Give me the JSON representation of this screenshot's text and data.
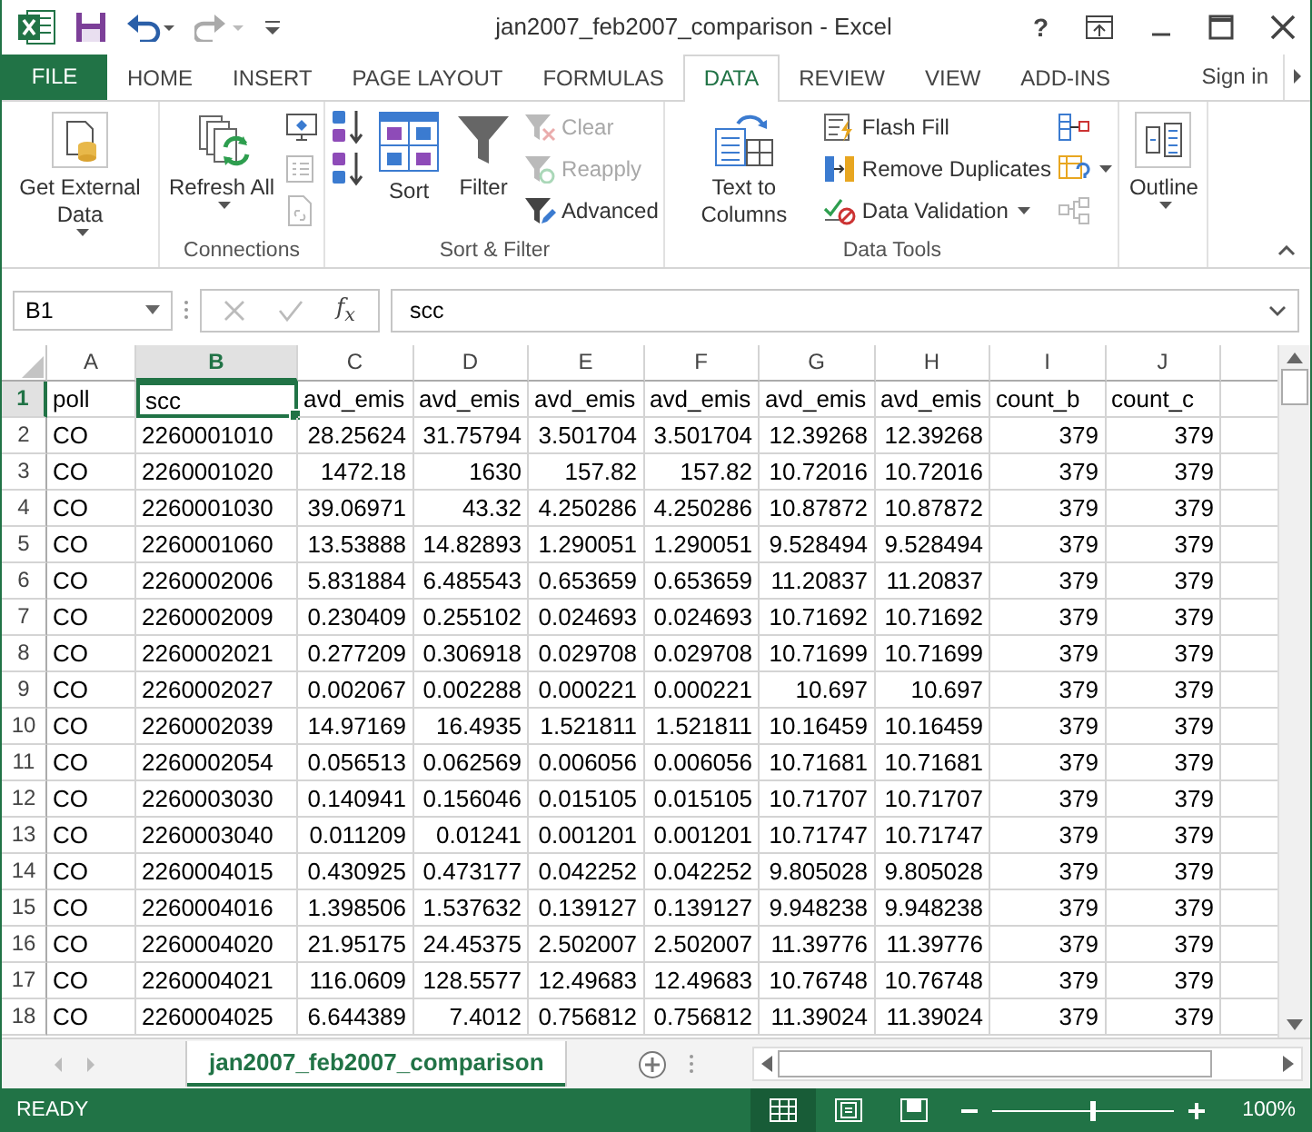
{
  "window": {
    "title": "jan2007_feb2007_comparison - Excel",
    "help": "?"
  },
  "ribbon_tabs": [
    {
      "label": "FILE",
      "kind": "file",
      "selected": false
    },
    {
      "label": "HOME",
      "kind": "tab",
      "selected": false
    },
    {
      "label": "INSERT",
      "kind": "tab",
      "selected": false
    },
    {
      "label": "PAGE LAYOUT",
      "kind": "tab",
      "selected": false
    },
    {
      "label": "FORMULAS",
      "kind": "tab",
      "selected": false
    },
    {
      "label": "DATA",
      "kind": "tab",
      "selected": true
    },
    {
      "label": "REVIEW",
      "kind": "tab",
      "selected": false
    },
    {
      "label": "VIEW",
      "kind": "tab",
      "selected": false
    },
    {
      "label": "ADD-INS",
      "kind": "tab",
      "selected": false
    }
  ],
  "sign_in": "Sign in",
  "ribbon_groups": [
    {
      "items": [
        {
          "kind": "large",
          "label": "Get External Data",
          "dropdown": true,
          "disabled": false
        }
      ]
    },
    {
      "label": "Connections",
      "items": [
        {
          "kind": "large",
          "label": "Refresh All",
          "dropdown": true,
          "disabled": false
        },
        {
          "kind": "stack",
          "commands": [
            {
              "disabled": false
            },
            {
              "disabled": true
            },
            {
              "disabled": true
            }
          ]
        }
      ]
    },
    {
      "label": "Sort & Filter",
      "items": [
        {
          "kind": "stack",
          "commands": [
            {
              "disabled": false
            },
            {
              "disabled": false
            }
          ]
        },
        {
          "kind": "large",
          "label": "Sort",
          "disabled": false
        },
        {
          "kind": "large",
          "label": "Filter",
          "disabled": false
        },
        {
          "kind": "stack",
          "commands": [
            {
              "label": "Clear",
              "disabled": true
            },
            {
              "label": "Reapply",
              "disabled": true
            },
            {
              "label": "Advanced",
              "disabled": false
            }
          ]
        }
      ]
    },
    {
      "label": "Data Tools",
      "items": [
        {
          "kind": "large",
          "label": "Text to Columns",
          "disabled": false
        },
        {
          "kind": "stack",
          "commands": [
            {
              "label": "Flash Fill",
              "disabled": false
            },
            {
              "label": "Remove Duplicates",
              "disabled": false
            },
            {
              "label": "Data Validation",
              "dropdown": true,
              "disabled": false
            }
          ]
        },
        {
          "kind": "stack",
          "commands": [
            {
              "disabled": false
            },
            {
              "dropdown": true,
              "disabled": false
            },
            {
              "disabled": true
            }
          ]
        }
      ]
    },
    {
      "items": [
        {
          "kind": "large",
          "label": "Outline",
          "dropdown": true,
          "disabled": false
        }
      ]
    }
  ],
  "formula_bar": {
    "name_box": "B1",
    "function_label": "f$_{x}$",
    "formula": "scc"
  },
  "sheet": {
    "columns": [
      {
        "label": "A",
        "kind": "text",
        "selected": false
      },
      {
        "label": "B",
        "kind": "text",
        "selected": true
      },
      {
        "label": "C",
        "kind": "number",
        "selected": false
      },
      {
        "label": "D",
        "kind": "number",
        "selected": false
      },
      {
        "label": "E",
        "kind": "number",
        "selected": false
      },
      {
        "label": "F",
        "kind": "number",
        "selected": false
      },
      {
        "label": "G",
        "kind": "number",
        "selected": false
      },
      {
        "label": "H",
        "kind": "number",
        "selected": false
      },
      {
        "label": "I",
        "kind": "number",
        "selected": false
      },
      {
        "label": "J",
        "kind": "number",
        "selected": false
      }
    ],
    "rows": [
      {
        "number": "1",
        "kind": "header",
        "selected": true,
        "cells": [
          "poll",
          "scc",
          "avd_emis",
          "avd_emis",
          "avd_emis",
          "avd_emis",
          "avd_emis",
          "avd_emis",
          "count_b",
          "count_c"
        ]
      },
      {
        "number": "2",
        "kind": "data",
        "selected": false,
        "cells": [
          "CO",
          "2260001010",
          "28.25624",
          "31.75794",
          "3.501704",
          "3.501704",
          "12.39268",
          "12.39268",
          "379",
          "379"
        ]
      },
      {
        "number": "3",
        "kind": "data",
        "selected": false,
        "cells": [
          "CO",
          "2260001020",
          "1472.18",
          "1630",
          "157.82",
          "157.82",
          "10.72016",
          "10.72016",
          "379",
          "379"
        ]
      },
      {
        "number": "4",
        "kind": "data",
        "selected": false,
        "cells": [
          "CO",
          "2260001030",
          "39.06971",
          "43.32",
          "4.250286",
          "4.250286",
          "10.87872",
          "10.87872",
          "379",
          "379"
        ]
      },
      {
        "number": "5",
        "kind": "data",
        "selected": false,
        "cells": [
          "CO",
          "2260001060",
          "13.53888",
          "14.82893",
          "1.290051",
          "1.290051",
          "9.528494",
          "9.528494",
          "379",
          "379"
        ]
      },
      {
        "number": "6",
        "kind": "data",
        "selected": false,
        "cells": [
          "CO",
          "2260002006",
          "5.831884",
          "6.485543",
          "0.653659",
          "0.653659",
          "11.20837",
          "11.20837",
          "379",
          "379"
        ]
      },
      {
        "number": "7",
        "kind": "data",
        "selected": false,
        "cells": [
          "CO",
          "2260002009",
          "0.230409",
          "0.255102",
          "0.024693",
          "0.024693",
          "10.71692",
          "10.71692",
          "379",
          "379"
        ]
      },
      {
        "number": "8",
        "kind": "data",
        "selected": false,
        "cells": [
          "CO",
          "2260002021",
          "0.277209",
          "0.306918",
          "0.029708",
          "0.029708",
          "10.71699",
          "10.71699",
          "379",
          "379"
        ]
      },
      {
        "number": "9",
        "kind": "data",
        "selected": false,
        "cells": [
          "CO",
          "2260002027",
          "0.002067",
          "0.002288",
          "0.000221",
          "0.000221",
          "10.697",
          "10.697",
          "379",
          "379"
        ]
      },
      {
        "number": "10",
        "kind": "data",
        "selected": false,
        "cells": [
          "CO",
          "2260002039",
          "14.97169",
          "16.4935",
          "1.521811",
          "1.521811",
          "10.16459",
          "10.16459",
          "379",
          "379"
        ]
      },
      {
        "number": "11",
        "kind": "data",
        "selected": false,
        "cells": [
          "CO",
          "2260002054",
          "0.056513",
          "0.062569",
          "0.006056",
          "0.006056",
          "10.71681",
          "10.71681",
          "379",
          "379"
        ]
      },
      {
        "number": "12",
        "kind": "data",
        "selected": false,
        "cells": [
          "CO",
          "2260003030",
          "0.140941",
          "0.156046",
          "0.015105",
          "0.015105",
          "10.71707",
          "10.71707",
          "379",
          "379"
        ]
      },
      {
        "number": "13",
        "kind": "data",
        "selected": false,
        "cells": [
          "CO",
          "2260003040",
          "0.011209",
          "0.01241",
          "0.001201",
          "0.001201",
          "10.71747",
          "10.71747",
          "379",
          "379"
        ]
      },
      {
        "number": "14",
        "kind": "data",
        "selected": false,
        "cells": [
          "CO",
          "2260004015",
          "0.430925",
          "0.473177",
          "0.042252",
          "0.042252",
          "9.805028",
          "9.805028",
          "379",
          "379"
        ]
      },
      {
        "number": "15",
        "kind": "data",
        "selected": false,
        "cells": [
          "CO",
          "2260004016",
          "1.398506",
          "1.537632",
          "0.139127",
          "0.139127",
          "9.948238",
          "9.948238",
          "379",
          "379"
        ]
      },
      {
        "number": "16",
        "kind": "data",
        "selected": false,
        "cells": [
          "CO",
          "2260004020",
          "21.95175",
          "24.45375",
          "2.502007",
          "2.502007",
          "11.39776",
          "11.39776",
          "379",
          "379"
        ]
      },
      {
        "number": "17",
        "kind": "data",
        "selected": false,
        "cells": [
          "CO",
          "2260004021",
          "116.0609",
          "128.5577",
          "12.49683",
          "12.49683",
          "10.76748",
          "10.76748",
          "379",
          "379"
        ]
      },
      {
        "number": "18",
        "kind": "data",
        "selected": false,
        "cells": [
          "CO",
          "2260004025",
          "6.644389",
          "7.4012",
          "0.756812",
          "0.756812",
          "11.39024",
          "11.39024",
          "379",
          "379"
        ]
      }
    ]
  },
  "sheet_tabs": [
    {
      "label": "jan2007_feb2007_comparison",
      "selected": true
    }
  ],
  "status_bar": {
    "status": "READY",
    "views": [
      {
        "selected": true
      },
      {
        "selected": false
      },
      {
        "selected": false
      }
    ],
    "level": 0.55,
    "zoom": "100%"
  }
}
